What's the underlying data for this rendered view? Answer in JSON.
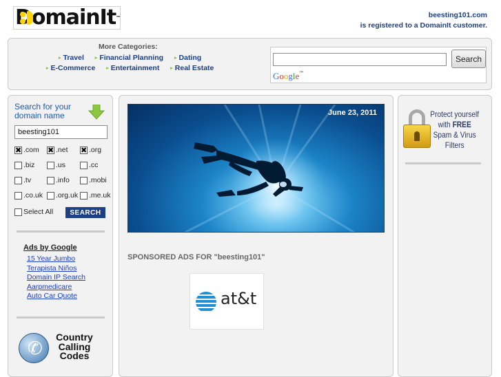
{
  "header": {
    "logo_text": "DomainIt",
    "logo_tm": "™",
    "domain": "beesting101.com",
    "registered_text": "is registered to a DomainIt customer."
  },
  "categories": {
    "title": "More Categories:",
    "row1": [
      "Travel",
      "Financial Planning",
      "Dating"
    ],
    "row2": [
      "E-Commerce",
      "Entertainment",
      "Real Estate"
    ]
  },
  "search": {
    "button_label": "Search",
    "brand": "Google™"
  },
  "domain_search": {
    "title_line1": "Search for your",
    "title_line2": "domain name",
    "input_value": "beesting101",
    "tlds": [
      {
        "label": ".com",
        "checked": true
      },
      {
        "label": ".net",
        "checked": true
      },
      {
        "label": ".org",
        "checked": true
      },
      {
        "label": ".biz",
        "checked": false
      },
      {
        "label": ".us",
        "checked": false
      },
      {
        "label": ".cc",
        "checked": false
      },
      {
        "label": ".tv",
        "checked": false
      },
      {
        "label": ".info",
        "checked": false
      },
      {
        "label": ".mobi",
        "checked": false
      },
      {
        "label": ".co.uk",
        "checked": false
      },
      {
        "label": ".org.uk",
        "checked": false
      },
      {
        "label": ".me.uk",
        "checked": false
      }
    ],
    "select_all_label": "Select All",
    "search_button_label": "SEARCH"
  },
  "ads": {
    "title": "Ads by Google",
    "links": [
      "15 Year Jumbo",
      "Terapista Niños",
      "Domain IP Search",
      "Aarpmedicare",
      "Auto Car Quote"
    ]
  },
  "country_codes": {
    "line1": "Country",
    "line2": "Calling",
    "line3": "Codes"
  },
  "hero": {
    "date": "June 23, 2011"
  },
  "sponsored": {
    "heading": "SPONSORED ADS FOR \"beesting101\"",
    "advertiser_logo_text": "at&t"
  },
  "protect": {
    "line1": "Protect yourself",
    "line2_prefix": "with ",
    "line2_strong": "FREE",
    "line3": "Spam & Virus",
    "line4": "Filters"
  },
  "colors": {
    "brand_blue": "#1d3f86",
    "link_blue": "#1d3fbf",
    "accent_green": "#8cc63e"
  }
}
